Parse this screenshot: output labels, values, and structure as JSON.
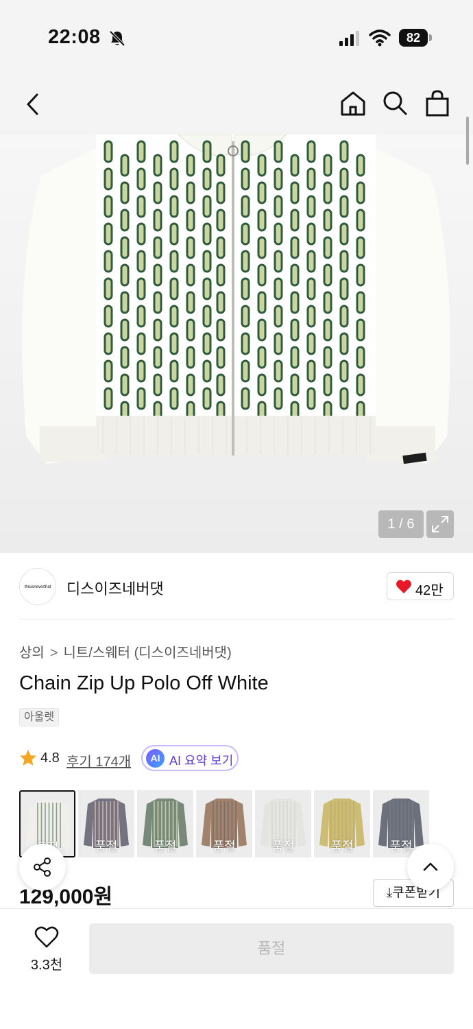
{
  "status_bar": {
    "time": "22:08",
    "battery": "82"
  },
  "header": {
    "back_icon": "chevron-left-icon",
    "home_icon": "home-icon",
    "search_icon": "search-icon",
    "bag_icon": "shopping-bag-icon"
  },
  "gallery": {
    "counter": "1 / 6"
  },
  "brand": {
    "logo_text": "thisisneverthat",
    "name": "디스이즈네버댓",
    "likes": "42만"
  },
  "breadcrumb": {
    "category": "상의",
    "separator": ">",
    "subcategory": "니트/스웨터 (디스이즈네버댓)"
  },
  "product": {
    "title": "Chain Zip Up Polo Off White",
    "badge": "아울렛",
    "rating": "4.8",
    "reviews": "후기 174개",
    "ai_badge": "AI",
    "ai_summary": "AI 요약 보기",
    "price": "129,000원",
    "coupon": "쿠폰받기"
  },
  "color_options": [
    {
      "label": "품절",
      "color": "#e9e7e0",
      "stripe": "#4c6b4a",
      "selected": true
    },
    {
      "label": "품절",
      "color": "#2a2a3c",
      "stripe": "#b8877c",
      "selected": false
    },
    {
      "label": "품절",
      "color": "#2f4a32",
      "stripe": "#a3b57a",
      "selected": false
    },
    {
      "label": "품절",
      "color": "#6e3f20",
      "stripe": "#3a2414",
      "selected": false
    },
    {
      "label": "품절",
      "color": "#d6d7d1",
      "stripe": "#c2c4be",
      "selected": false
    },
    {
      "label": "품절",
      "color": "#b39a2a",
      "stripe": "#9a8322",
      "selected": false
    },
    {
      "label": "품절",
      "color": "#1c2433",
      "stripe": "#2a3446",
      "selected": false
    }
  ],
  "bottom_bar": {
    "wishlist_count": "3.3천",
    "buy_button": "품절"
  }
}
